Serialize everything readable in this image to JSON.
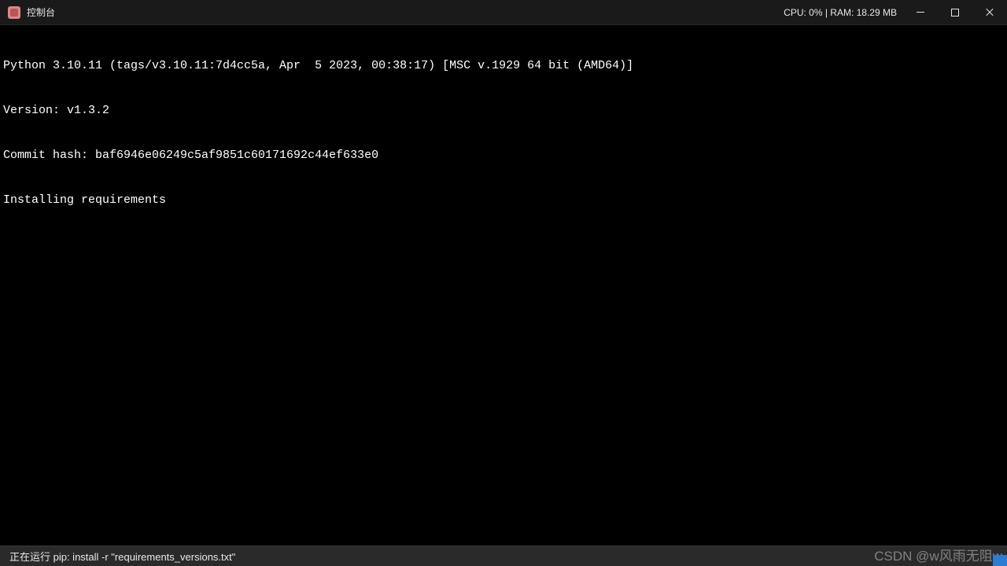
{
  "titlebar": {
    "title": "控制台",
    "stats": "CPU: 0% | RAM: 18.29 MB"
  },
  "console": {
    "lines": [
      "Python 3.10.11 (tags/v3.10.11:7d4cc5a, Apr  5 2023, 00:38:17) [MSC v.1929 64 bit (AMD64)]",
      "Version: v1.3.2",
      "Commit hash: baf6946e06249c5af9851c60171692c44ef633e0",
      "Installing requirements"
    ]
  },
  "statusbar": {
    "text": "正在运行 pip: install -r \"requirements_versions.txt\""
  },
  "watermark": "CSDN @w风雨无阻w"
}
